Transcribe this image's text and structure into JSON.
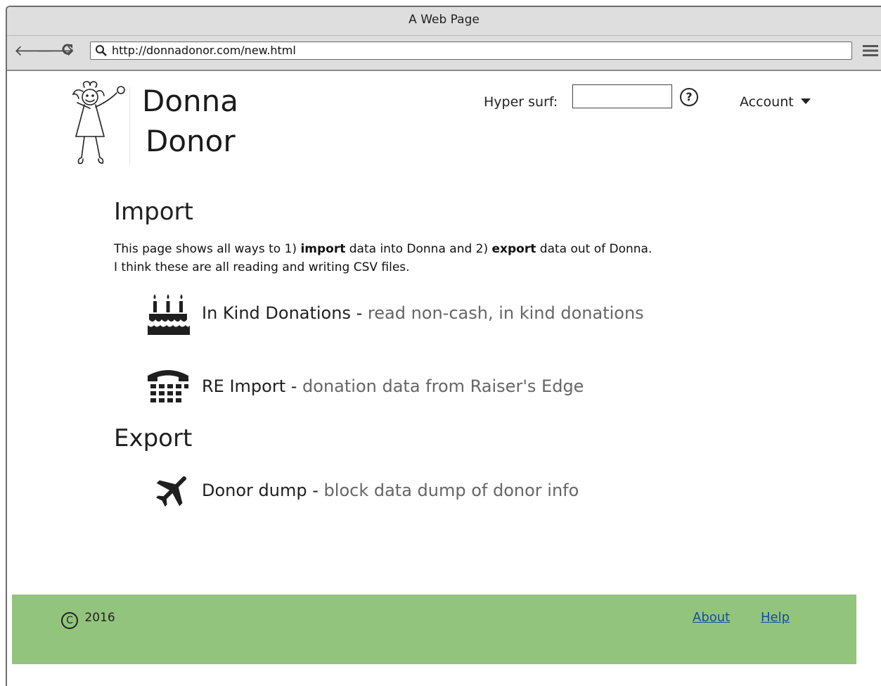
{
  "window": {
    "title": "A Web Page"
  },
  "browser": {
    "url": "http://donnadonor.com/new.html",
    "back_icon": "arrow-left-icon",
    "forward_icon": "arrow-right-icon",
    "reload_icon": "reload-icon",
    "menu_icon": "hamburger-menu-icon"
  },
  "header": {
    "brand_line1": "Donna",
    "brand_line2": "Donor",
    "search_label": "Hyper surf:",
    "search_value": "",
    "help_symbol": "?",
    "account_label": "Account"
  },
  "import": {
    "title": "Import",
    "intro": {
      "p1": "This page shows all ways to 1) ",
      "p1_bold": "import",
      "p2": " data into Donna and 2) ",
      "p2_bold": "export",
      "p3": " data out of Donna.",
      "line2": "I think these are all reading and writing CSV files."
    },
    "items": [
      {
        "name": "In Kind Donations",
        "separator": " - ",
        "description": "read non-cash, in kind donations",
        "icon": "birthday-cake-icon"
      },
      {
        "name": "RE Import",
        "separator": " - ",
        "description": "donation data from Raiser's Edge",
        "icon": "telephone-icon"
      }
    ]
  },
  "export": {
    "title": "Export",
    "items": [
      {
        "name": "Donor dump",
        "separator": " - ",
        "description": "block data dump of donor info",
        "icon": "airplane-icon"
      }
    ]
  },
  "footer": {
    "copyright_symbol": "C",
    "year": "2016",
    "links": [
      "About",
      "Help"
    ]
  },
  "colors": {
    "footer_bg": "#93c47d",
    "link": "#0b5394",
    "description": "#666666"
  }
}
